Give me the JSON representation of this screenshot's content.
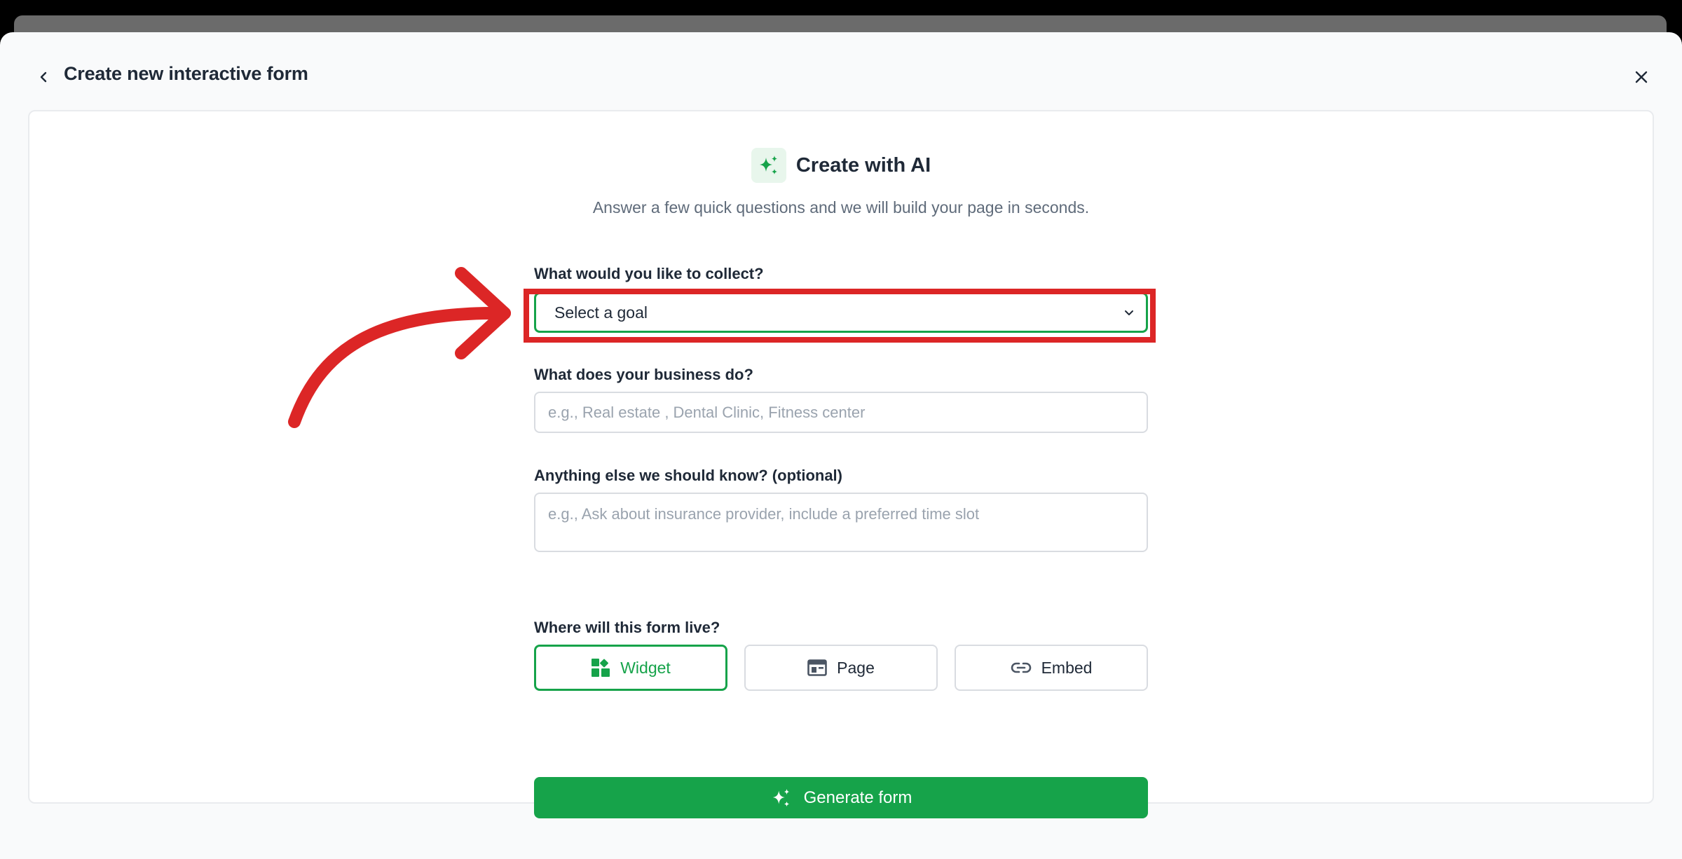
{
  "modal": {
    "title": "Create new interactive form"
  },
  "hero": {
    "title": "Create with AI",
    "subtitle": "Answer a few quick questions and we will build your page in seconds."
  },
  "fields": {
    "collect": {
      "label": "What would you like to collect?",
      "value": "Select a goal"
    },
    "business": {
      "label": "What does your business do?",
      "placeholder": "e.g., Real estate , Dental Clinic, Fitness center"
    },
    "extra": {
      "label": "Anything else we should know? (optional)",
      "placeholder": "e.g., Ask about insurance provider, include a preferred time slot"
    },
    "placement": {
      "label": "Where will this form live?",
      "options": [
        {
          "label": "Widget",
          "icon": "widget-icon",
          "selected": true
        },
        {
          "label": "Page",
          "icon": "page-icon",
          "selected": false
        },
        {
          "label": "Embed",
          "icon": "link-icon",
          "selected": false
        }
      ]
    }
  },
  "actions": {
    "generate_label": "Generate form"
  },
  "colors": {
    "accent": "#16a34a",
    "annotation": "#dc2626"
  }
}
